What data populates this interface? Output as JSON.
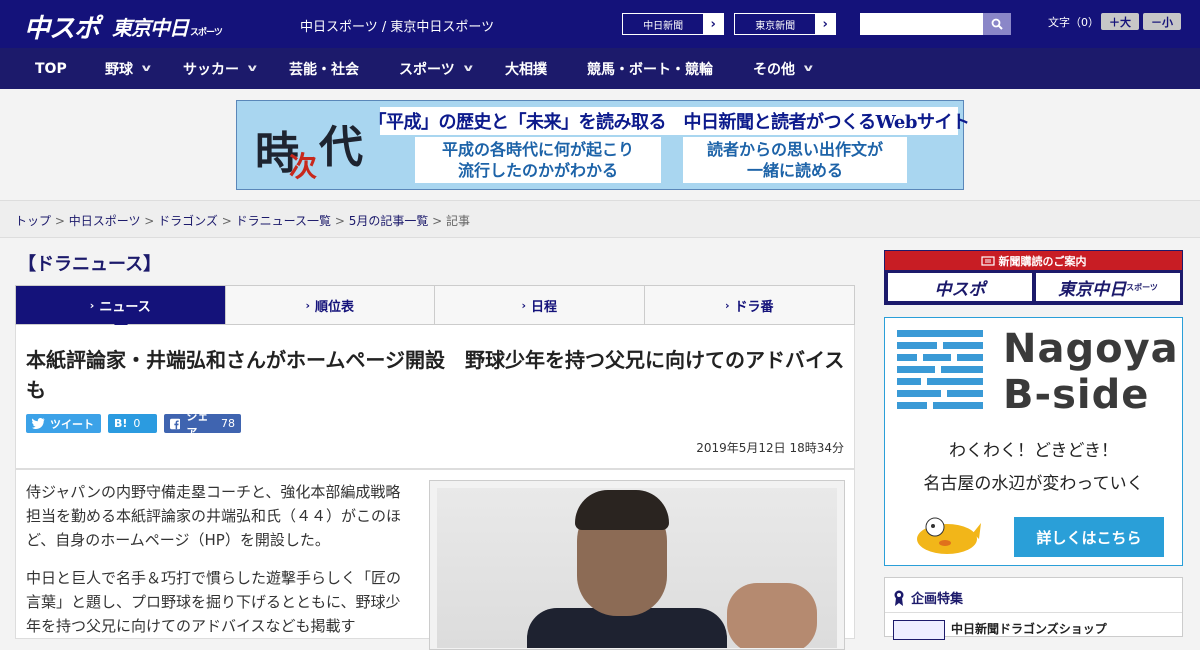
{
  "header": {
    "logo_chuspo": "中スポ",
    "logo_tokyo": "東京中日",
    "logo_tokyo_sub": "スポーツ",
    "title": "中日スポーツ / 東京中日スポーツ",
    "site_links": [
      "中日新聞",
      "東京新聞"
    ],
    "search_placeholder": "",
    "font_size_label": "文字（0）",
    "font_up": "＋大",
    "font_down": "－小",
    "brand_color": "#14127a"
  },
  "nav": {
    "items": [
      {
        "label": "TOP"
      },
      {
        "label": "野球"
      },
      {
        "label": "サッカー"
      },
      {
        "label": "芸能・社会"
      },
      {
        "label": "スポーツ"
      },
      {
        "label": "大相撲"
      },
      {
        "label": "競馬・ボート・競輪"
      },
      {
        "label": "その他"
      }
    ]
  },
  "ad_top": {
    "kanji": [
      "時",
      "次",
      "代"
    ],
    "headline": "「平成」の歴史と「未来」を読み取る　中日新聞と読者がつくるWebサイト",
    "box1": [
      "平成の各時代に何が起こり",
      "流行したのかがわかる"
    ],
    "box2": [
      "読者からの思い出作文が",
      "一緒に読める"
    ]
  },
  "breadcrumb": [
    "トップ",
    "中日スポーツ",
    "ドラゴンズ",
    "ドラニュース一覧",
    "5月の記事一覧",
    "記事"
  ],
  "section_title": "【ドラニュース】",
  "tabs": [
    {
      "label": "ニュース"
    },
    {
      "label": "順位表"
    },
    {
      "label": "日程"
    },
    {
      "label": "ドラ番"
    }
  ],
  "article": {
    "title": "本紙評論家・井端弘和さんがホームページ開設　野球少年を持つ父兄に向けてのアドバイスも",
    "share": {
      "tweet": "ツイート",
      "hatena": "B!",
      "hatena_count": "0",
      "facebook": "シェア",
      "facebook_count": "78"
    },
    "date": "2019年5月12日 18時34分",
    "paragraphs": [
      "侍ジャパンの内野守備走塁コーチと、強化本部編成戦略担当を勤める本紙評論家の井端弘和氏（４４）がこのほど、自身のホームページ（HP）を開設した。",
      "中日と巨人で名手＆巧打で慣らした遊撃手らしく「匠の言葉」と題し、プロ野球を掘り下げるとともに、野球少年を持つ父兄に向けてのアドバイスなども掲載す"
    ]
  },
  "sidebar": {
    "subscribe_head": "新聞購読のご案内",
    "subscribe_logo1": "中スポ",
    "subscribe_logo2": "東京中日",
    "subscribe_logo2_sub": "スポーツ",
    "bside_title": [
      "Nagoya",
      "B-side"
    ],
    "bside_line1": "わくわく！どきどき！",
    "bside_line2": "名古屋の水辺が変わっていく",
    "bside_button": "詳しくはこちら",
    "feature_title": "企画特集",
    "feature_item": "中日新聞ドラゴンズショップ"
  }
}
